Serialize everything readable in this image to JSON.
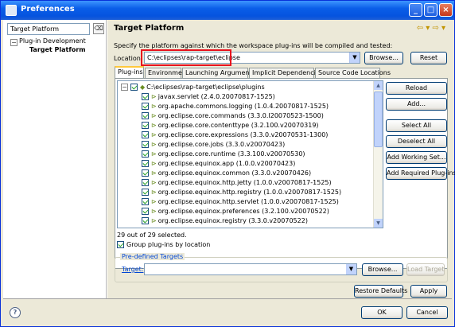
{
  "window": {
    "title": "Preferences"
  },
  "nav": {
    "filter_value": "Target Platform",
    "tree": [
      {
        "label": "Plug-in Development",
        "expander": "−"
      },
      {
        "label": "Target Platform"
      }
    ]
  },
  "header": {
    "title": "Target Platform",
    "nav_glyphs": "⇦ ▾ ⇨ ▾"
  },
  "content": {
    "description": "Specify the platform against which the workspace plug-ins will be compiled and tested:",
    "location_label": "Location:",
    "location_value": "C:\\eclipses\\rap-target\\eclipse",
    "browse_label": "Browse...",
    "reset_label": "Reset"
  },
  "tabs": [
    "Plug-ins",
    "Environment",
    "Launching Arguments",
    "Implicit Dependencies",
    "Source Code Locations"
  ],
  "plugins": {
    "root": "C:\\eclipses\\rap-target\\eclipse\\plugins",
    "items": [
      "javax.servlet (2.4.0.20070817-1525)",
      "org.apache.commons.logging (1.0.4.20070817-1525)",
      "org.eclipse.core.commands (3.3.0.I20070523-1500)",
      "org.eclipse.core.contenttype (3.2.100.v20070319)",
      "org.eclipse.core.expressions (3.3.0.v20070531-1300)",
      "org.eclipse.core.jobs (3.3.0.v20070423)",
      "org.eclipse.core.runtime (3.3.100.v20070530)",
      "org.eclipse.equinox.app (1.0.0.v20070423)",
      "org.eclipse.equinox.common (3.3.0.v20070426)",
      "org.eclipse.equinox.http.jetty (1.0.0.v20070817-1525)",
      "org.eclipse.equinox.http.registry (1.0.0.v20070817-1525)",
      "org.eclipse.equinox.http.servlet (1.0.0.v20070817-1525)",
      "org.eclipse.equinox.preferences (3.2.100.v20070522)",
      "org.eclipse.equinox.registry (3.3.0.v20070522)"
    ],
    "count_text": "29 out of 29 selected.",
    "group_label": "Group plug-ins by location"
  },
  "side_buttons": [
    "Reload",
    "Add...",
    "Select All",
    "Deselect All",
    "Add Working Set...",
    "Add Required Plug-ins"
  ],
  "predefined": {
    "legend": "Pre-defined Targets",
    "target_label": "Target:",
    "browse_label": "Browse...",
    "load_label": "Load Target"
  },
  "footer": {
    "restore_label": "Restore Defaults",
    "apply_label": "Apply",
    "ok_label": "OK",
    "cancel_label": "Cancel",
    "help_glyph": "?"
  },
  "colors": {
    "accent": "#0a5ee8",
    "highlight": "#e8121d",
    "link": "#0046d5"
  }
}
